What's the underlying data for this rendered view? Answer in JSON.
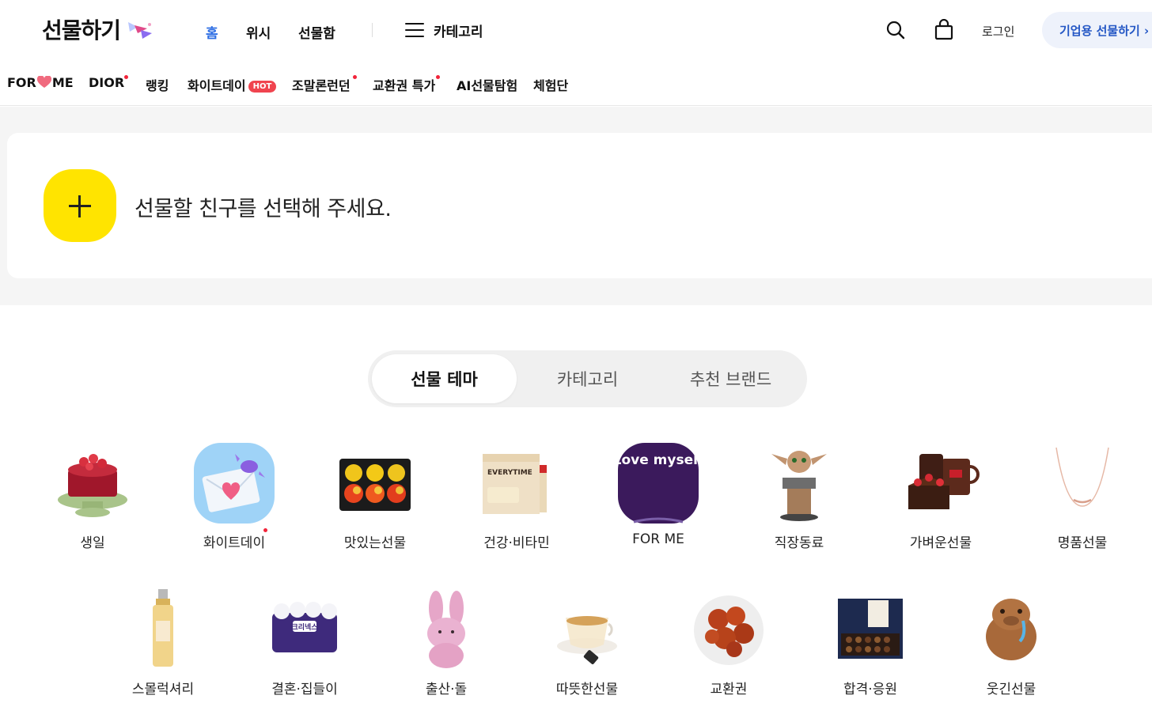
{
  "header": {
    "logo": "선물하기",
    "nav": [
      "홈",
      "위시",
      "선물함"
    ],
    "category": "카테고리",
    "login": "로그인",
    "business": "기업용 선물하기 ›"
  },
  "subnav": {
    "for_me_a": "FOR",
    "for_me_b": "ME",
    "dior": "DIOR",
    "ranking": "랭킹",
    "whiteday": "화이트데이",
    "hot": "HOT",
    "small_luxury": "조말론런던",
    "voucher": "교환권 특가",
    "ai": "AI선물탐험",
    "experience": "체험단"
  },
  "friend": {
    "prompt": "선물할 친구를 선택해 주세요."
  },
  "tabs": [
    "선물 테마",
    "카테고리",
    "추천 브랜드"
  ],
  "themes_row1": [
    "생일",
    "화이트데이",
    "맛있는선물",
    "건강·비타민",
    "FOR ME",
    "직장동료",
    "가벼운선물",
    "명품선물"
  ],
  "themes_row2": [
    "스몰럭셔리",
    "결혼·집들이",
    "출산·돌",
    "따뜻한선물",
    "교환권",
    "합격·응원",
    "웃긴선물"
  ],
  "image_text": {
    "vitamin": "EVERYTIME",
    "forme": "Love myself",
    "tissue": "크리넥스"
  },
  "colors": {
    "accent_blue": "#2f6fe4",
    "yellow": "#ffe400",
    "red_dot": "#f2243a"
  }
}
